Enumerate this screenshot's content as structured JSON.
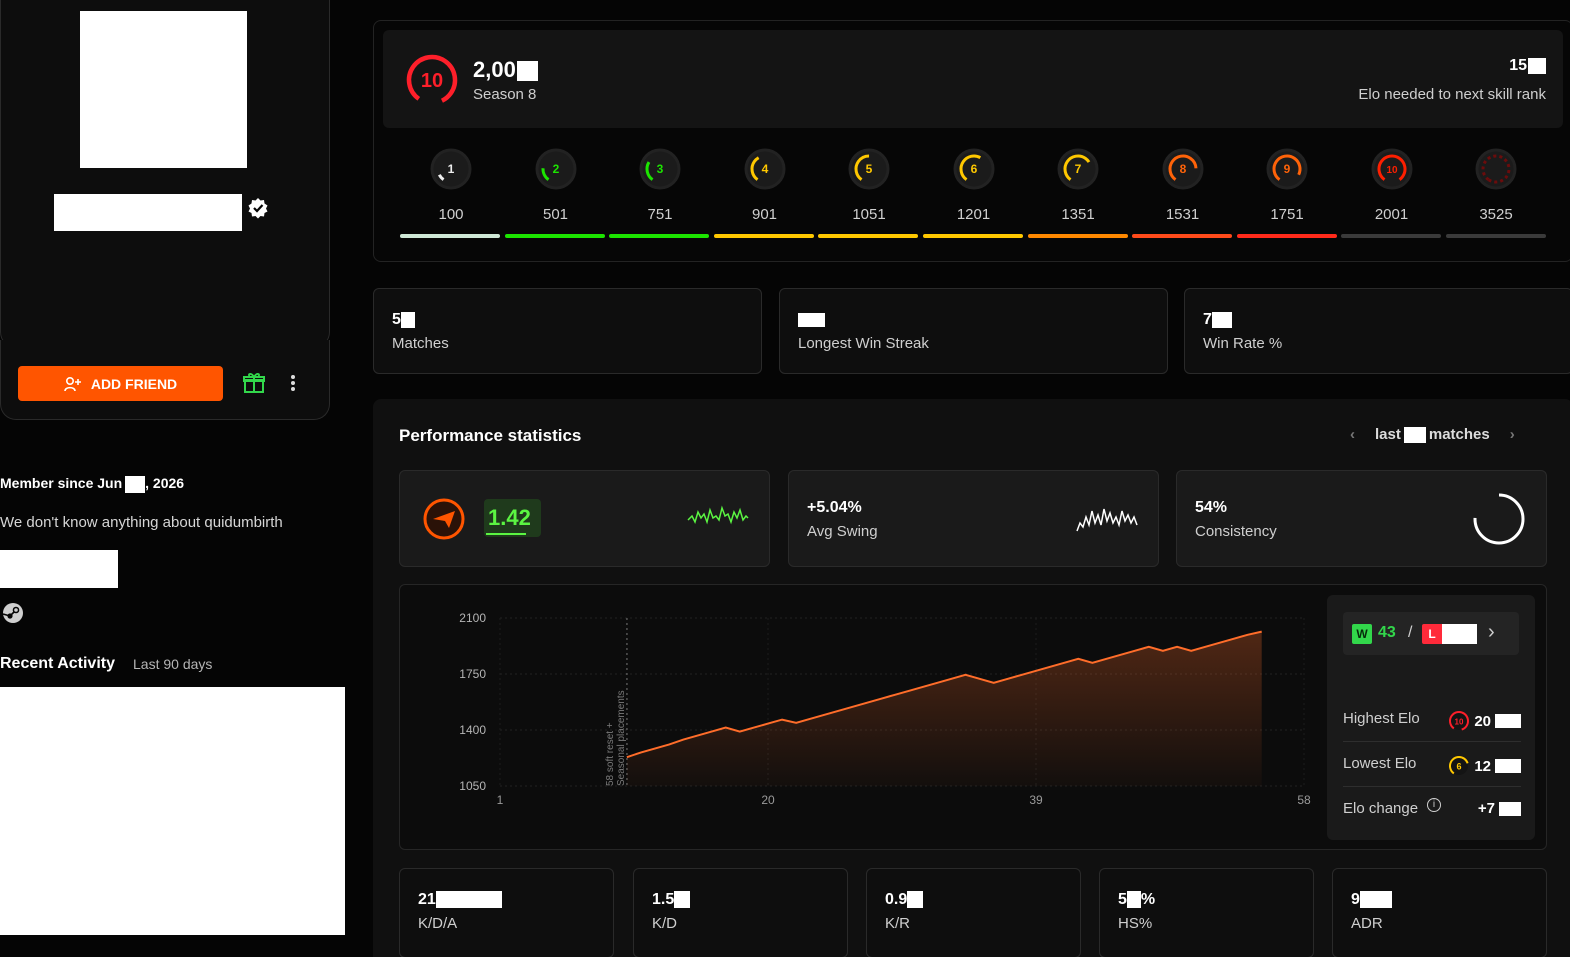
{
  "profile": {
    "add_friend_label": "ADD FRIEND",
    "member_since": "Member since Jun",
    "member_year": ", 2026",
    "about": "We don't know anything about quidumbirth",
    "recent_activity_title": "Recent Activity",
    "recent_activity_range": "Last 90 days"
  },
  "rank": {
    "current_level": "10",
    "elo": "2,00",
    "season": "Season 8",
    "elo_needed_value": "15",
    "elo_needed_label": "Elo needed to next skill rank",
    "levels": [
      {
        "level": "1",
        "elo": "100",
        "color": "#eeeeee",
        "fill": 0.1
      },
      {
        "level": "2",
        "elo": "501",
        "color": "#1ce400",
        "fill": 0.2
      },
      {
        "level": "3",
        "elo": "751",
        "color": "#1ce400",
        "fill": 0.3
      },
      {
        "level": "4",
        "elo": "901",
        "color": "#ffc800",
        "fill": 0.4
      },
      {
        "level": "5",
        "elo": "1051",
        "color": "#ffc800",
        "fill": 0.5
      },
      {
        "level": "6",
        "elo": "1201",
        "color": "#ffc800",
        "fill": 0.6
      },
      {
        "level": "7",
        "elo": "1351",
        "color": "#ffc800",
        "fill": 0.7
      },
      {
        "level": "8",
        "elo": "1531",
        "color": "#ff6309",
        "fill": 0.8
      },
      {
        "level": "9",
        "elo": "1751",
        "color": "#ff6309",
        "fill": 0.9
      },
      {
        "level": "10",
        "elo": "2001",
        "color": "#fe1f00",
        "fill": 1.0
      },
      {
        "level": "",
        "elo": "3525",
        "color": "#6b0c0c",
        "fill": 1.0
      }
    ],
    "bar_colors": [
      "#cfe8d6",
      "#1ce400",
      "#1ce400",
      "#ffc800",
      "#ffc800",
      "#ffc800",
      "#ff8800",
      "#ff4a1a",
      "#ff2a1a",
      "#3a3a3a",
      "#3a3a3a"
    ]
  },
  "stats_top": [
    {
      "value": "5",
      "label": "Matches"
    },
    {
      "value": "",
      "label": "Longest Win Streak"
    },
    {
      "value": "7",
      "label": "Win Rate %"
    }
  ],
  "performance": {
    "title": "Performance statistics",
    "nav_prefix": "last",
    "nav_suffix": "matches",
    "rating_value": "1.42",
    "swing_value": "+5.04%",
    "swing_label": "Avg Swing",
    "consistency_value": "54%",
    "consistency_label": "Consistency"
  },
  "chart_data": {
    "type": "area",
    "title": "",
    "xlabel": "",
    "ylabel": "",
    "x_ticks": [
      "1",
      "20",
      "39",
      "58"
    ],
    "y_ticks": [
      "2100",
      "1750",
      "1400",
      "1050"
    ],
    "xlim": [
      1,
      58
    ],
    "ylim": [
      1050,
      2100
    ],
    "annotation_line1": "58 soft reset +",
    "annotation_line2": "Seasonal placements",
    "annotation_x": 10,
    "series": [
      {
        "x": [
          10,
          11,
          12,
          13,
          14,
          15,
          16,
          17,
          18,
          19,
          20,
          21,
          22,
          23,
          24,
          25,
          26,
          27,
          28,
          29,
          30,
          31,
          32,
          33,
          34,
          35,
          36,
          37,
          38,
          39,
          40,
          41,
          42,
          43,
          44,
          45,
          46,
          47,
          48,
          49,
          50,
          51,
          52,
          53,
          54,
          55
        ],
        "y": [
          1230,
          1260,
          1285,
          1310,
          1340,
          1365,
          1390,
          1415,
          1390,
          1415,
          1440,
          1465,
          1445,
          1470,
          1495,
          1520,
          1545,
          1570,
          1595,
          1620,
          1645,
          1670,
          1695,
          1720,
          1745,
          1720,
          1695,
          1720,
          1745,
          1770,
          1795,
          1820,
          1845,
          1820,
          1845,
          1870,
          1895,
          1920,
          1895,
          1920,
          1895,
          1920,
          1945,
          1970,
          1995,
          2015
        ]
      }
    ],
    "line_color": "#ff6d2a"
  },
  "elo_summary": {
    "wins_badge": "W",
    "wins": "43",
    "separator": "/",
    "losses_badge": "L",
    "highest_label": "Highest Elo",
    "highest_level": "10",
    "highest_value": "20",
    "lowest_label": "Lowest Elo",
    "lowest_level": "6",
    "lowest_value": "12",
    "change_label": "Elo change",
    "change_value": "+7"
  },
  "stats_bottom": [
    {
      "value": "21",
      "label": "K/D/A"
    },
    {
      "value": "1.5",
      "label": "K/D"
    },
    {
      "value": "0.9",
      "label": "K/R"
    },
    {
      "value": "5",
      "value_suffix": "%",
      "label": "HS%"
    },
    {
      "value": "9",
      "label": "ADR"
    }
  ]
}
